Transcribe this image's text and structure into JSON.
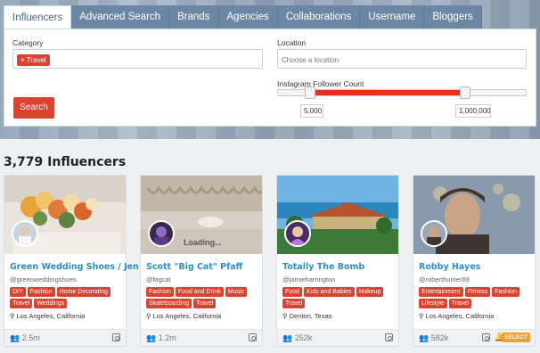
{
  "tabs": [
    "Influencers",
    "Advanced Search",
    "Brands",
    "Agencies",
    "Collaborations",
    "Username",
    "Bloggers"
  ],
  "search": {
    "category_label": "Category",
    "category_chip": "× Travel",
    "location_label": "Location",
    "location_placeholder": "Choose a location",
    "follower_label": "Instagram Follower Count",
    "follower_min": "5,000",
    "follower_max": "1,000,000",
    "button": "Search"
  },
  "results_count": "3,779 Influencers",
  "cards": [
    {
      "name": "Green Wedding Shoes / Jen",
      "handle": "@greenweddingshoes",
      "tags": [
        "DIY",
        "Fashion",
        "Home Decorating",
        "Travel",
        "Weddings"
      ],
      "location": "Los Angeles, California",
      "followers": "2.5m"
    },
    {
      "name": "Scott \"Big Cat\" Pfaff",
      "handle": "@bigcat",
      "tags": [
        "Fashion",
        "Food and Drink",
        "Music",
        "Skateboarding",
        "Travel"
      ],
      "location": "Los Angeles, California",
      "followers": "1.2m",
      "image_text": "Loading..."
    },
    {
      "name": "Totally The Bomb",
      "handle": "@jamieharrington",
      "tags": [
        "Food",
        "Kids and Babies",
        "Makeup",
        "Travel"
      ],
      "location": "Denton, Texas",
      "followers": "252k"
    },
    {
      "name": "Robby Hayes",
      "handle": "@roberthunter89",
      "tags": [
        "Entertainment",
        "Fitness",
        "Fashion",
        "Lifestyle",
        "Travel"
      ],
      "location": "Los Angeles, California",
      "followers": "582k",
      "badge": "SELECT"
    }
  ],
  "colors": {
    "accent": "#d9432f",
    "link": "#2f8fc1",
    "tab": "#6c87a3"
  }
}
